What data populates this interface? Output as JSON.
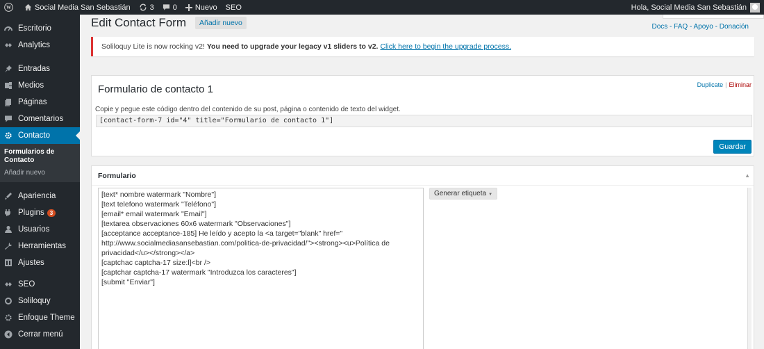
{
  "admin_bar": {
    "site_name": "Social Media San Sebastián",
    "updates_count": "3",
    "comments_count": "0",
    "new_label": "Nuevo",
    "seo_label": "SEO",
    "greeting": "Hola, Social Media San Sebastián"
  },
  "sidebar": {
    "items": [
      {
        "label": "Escritorio",
        "icon": "dashboard-icon"
      },
      {
        "label": "Analytics",
        "icon": "analytics-icon"
      },
      {
        "label": "Entradas",
        "icon": "pin-icon"
      },
      {
        "label": "Medios",
        "icon": "media-icon"
      },
      {
        "label": "Páginas",
        "icon": "pages-icon"
      },
      {
        "label": "Comentarios",
        "icon": "comments-icon"
      },
      {
        "label": "Contacto",
        "icon": "contact-gear-icon"
      },
      {
        "label": "Apariencia",
        "icon": "appearance-icon"
      },
      {
        "label": "Plugins",
        "icon": "plugins-icon",
        "badge": "3"
      },
      {
        "label": "Usuarios",
        "icon": "users-icon"
      },
      {
        "label": "Herramientas",
        "icon": "tools-icon"
      },
      {
        "label": "Ajustes",
        "icon": "settings-icon"
      },
      {
        "label": "SEO",
        "icon": "seo-icon"
      },
      {
        "label": "Soliloquy",
        "icon": "soliloquy-icon"
      },
      {
        "label": "Enfoque Theme",
        "icon": "theme-icon"
      },
      {
        "label": "Cerrar menú",
        "icon": "collapse-icon"
      }
    ],
    "submenu": {
      "items": [
        {
          "label": "Formularios de Contacto"
        },
        {
          "label": "Añadir nuevo"
        }
      ]
    }
  },
  "header": {
    "title": "Edit Contact Form",
    "add_new": "Añadir nuevo",
    "doc_links": "Docs - FAQ - Apoyo - Donación"
  },
  "notice": {
    "prefix": "Soliloquy Lite is now rocking v2!",
    "bold": "You need to upgrade your legacy v1 sliders to v2.",
    "link": "Click here to begin the upgrade process."
  },
  "form": {
    "title": "Formulario de contacto 1",
    "duplicate": "Duplicate",
    "separator": "|",
    "delete": "Eliminar",
    "shortcode_desc": "Copie y pegue este código dentro del contenido de su post, página o contenido de texto del widget.",
    "shortcode": "[contact-form-7 id=\"4\" title=\"Formulario de contacto 1\"]",
    "save": "Guardar"
  },
  "form_box": {
    "header": "Formulario",
    "generate_tag": "Generar etiqueta",
    "lines": [
      "[text* nombre watermark \"Nombre\"]",
      "[text telefono watermark \"Teléfono\"]",
      "[email* email watermark \"Email\"]",
      "[textarea observaciones 60x6 watermark \"Observaciones\"]",
      "[acceptance acceptance-185] He leído y acepto la <a target=\"blank\" href=\"",
      "http://www.socialmediasansebastian.com/politica-de-privacidad/\"><strong><u>Política de",
      "privacidad</u></strong></a>",
      "[captchac captcha-17 size:l]<br />",
      "[captchar captcha-17 watermark \"Introduzca los caracteres\"]",
      "[submit \"Enviar\"]"
    ]
  }
}
